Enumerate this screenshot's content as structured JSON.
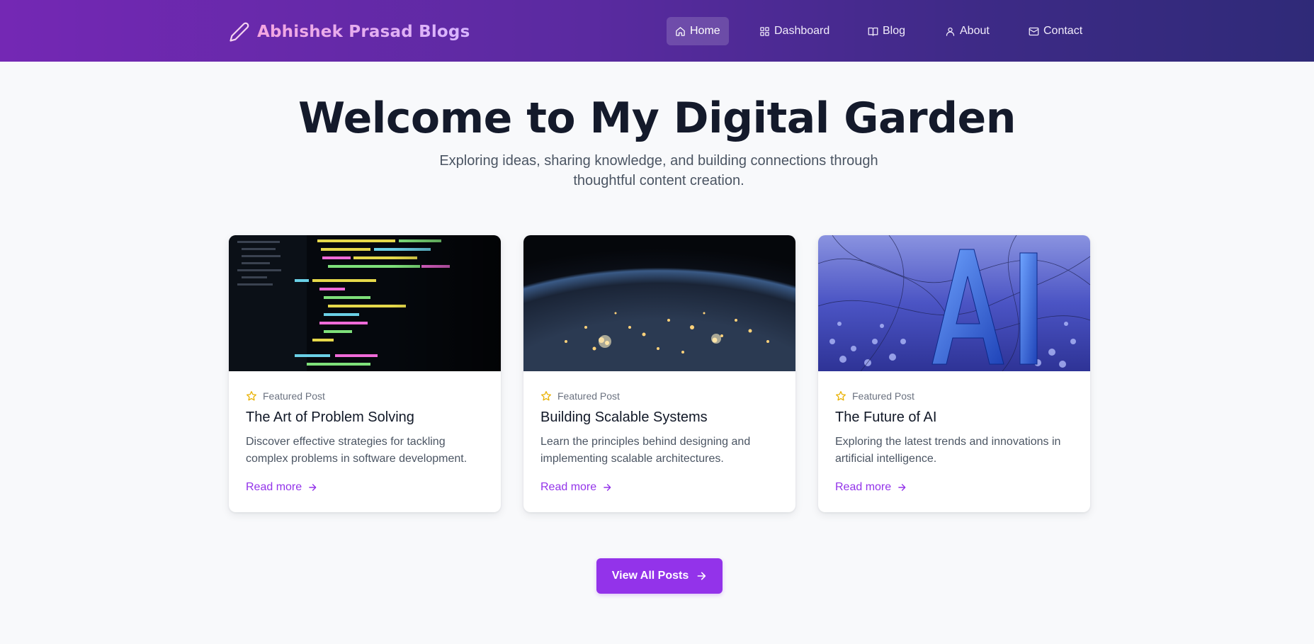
{
  "brand": {
    "name": "Abhishek Prasad Blogs",
    "icon": "pencil-icon"
  },
  "nav": {
    "items": [
      {
        "label": "Home",
        "icon": "home-icon",
        "active": true
      },
      {
        "label": "Dashboard",
        "icon": "dashboard-icon",
        "active": false
      },
      {
        "label": "Blog",
        "icon": "book-icon",
        "active": false
      },
      {
        "label": "About",
        "icon": "user-icon",
        "active": false
      },
      {
        "label": "Contact",
        "icon": "mail-icon",
        "active": false
      }
    ]
  },
  "hero": {
    "title": "Welcome to My Digital Garden",
    "subtitle": "Exploring ideas, sharing knowledge, and building connections through thoughtful content creation."
  },
  "posts": [
    {
      "badge": "Featured Post",
      "title": "The Art of Problem Solving",
      "description": "Discover effective strategies for tackling complex problems in software development.",
      "link": "Read more",
      "image": "code-editor-image"
    },
    {
      "badge": "Featured Post",
      "title": "Building Scalable Systems",
      "description": "Learn the principles behind designing and implementing scalable architectures.",
      "link": "Read more",
      "image": "earth-night-image"
    },
    {
      "badge": "Featured Post",
      "title": "The Future of AI",
      "description": "Exploring the latest trends and innovations in artificial intelligence.",
      "link": "Read more",
      "image": "ai-letters-image"
    }
  ],
  "cta": {
    "label": "View All Posts",
    "icon": "arrow-right-icon"
  },
  "colors": {
    "accent": "#9333ea",
    "star": "#eab308",
    "header_start": "#7428b4",
    "header_end": "#2f2a78"
  }
}
